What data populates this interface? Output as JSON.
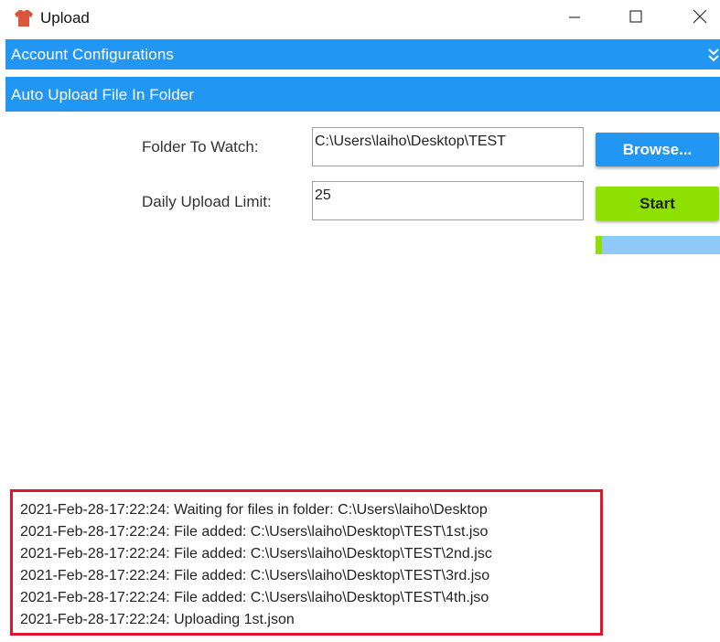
{
  "window": {
    "title": "Upload",
    "icon": "tshirt-icon",
    "controls": [
      "minimize-icon",
      "maximize-icon",
      "close-icon"
    ]
  },
  "sections": {
    "account": {
      "label": "Account Configurations",
      "expand_icon": "double-chevron-down-icon"
    },
    "auto_upload": {
      "label": "Auto Upload File In Folder"
    }
  },
  "form": {
    "folder_label": "Folder To Watch:",
    "folder_value": "C:\\Users\\laiho\\Desktop\\TEST",
    "limit_label": "Daily Upload Limit:",
    "limit_value": "25",
    "browse_label": "Browse...",
    "start_label": "Start",
    "progress_fraction": 0.05
  },
  "log": [
    "2021-Feb-28-17:22:24: Waiting for files in folder: C:\\Users\\laiho\\Desktop",
    "2021-Feb-28-17:22:24: File added: C:\\Users\\laiho\\Desktop\\TEST\\1st.jso",
    "2021-Feb-28-17:22:24: File added: C:\\Users\\laiho\\Desktop\\TEST\\2nd.jsc",
    "2021-Feb-28-17:22:24: File added: C:\\Users\\laiho\\Desktop\\TEST\\3rd.jso",
    "2021-Feb-28-17:22:24: File added: C:\\Users\\laiho\\Desktop\\TEST\\4th.jso",
    "2021-Feb-28-17:22:24: Uploading 1st.json"
  ],
  "colors": {
    "accent_blue": "#2196f3",
    "start_green": "#8ee000",
    "progress_track": "#90caf9",
    "log_border": "#e0142a"
  }
}
